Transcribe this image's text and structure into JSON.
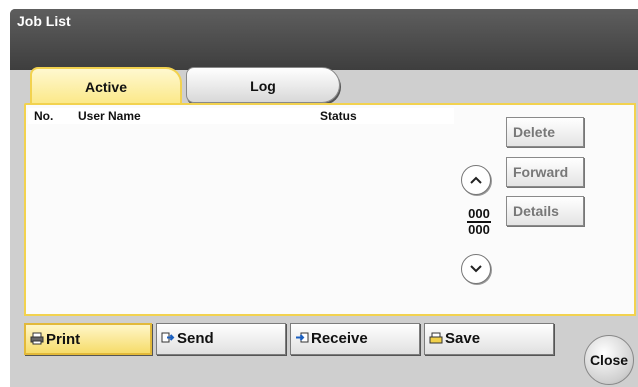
{
  "window": {
    "title": "Job List"
  },
  "tabs": [
    {
      "label": "Active",
      "selected": true
    },
    {
      "label": "Log",
      "selected": false
    }
  ],
  "table": {
    "columns": [
      "No.",
      "User Name",
      "Status"
    ],
    "rows": []
  },
  "actions": {
    "delete_label": "Delete",
    "forward_label": "Forward",
    "details_label": "Details"
  },
  "pager": {
    "current": "000",
    "total": "000",
    "up_icon": "chevron-up-icon",
    "down_icon": "chevron-down-icon"
  },
  "bottom_tabs": [
    {
      "label": "Print",
      "icon": "printer-icon",
      "selected": true
    },
    {
      "label": "Send",
      "icon": "send-icon",
      "selected": false
    },
    {
      "label": "Receive",
      "icon": "receive-icon",
      "selected": false
    },
    {
      "label": "Save",
      "icon": "save-icon",
      "selected": false
    }
  ],
  "close_label": "Close",
  "colors": {
    "accent": "#f2d24f",
    "active_tab_fill": "#fbe98a",
    "frame": "#4a4a4a",
    "disabled_text": "#777777"
  }
}
